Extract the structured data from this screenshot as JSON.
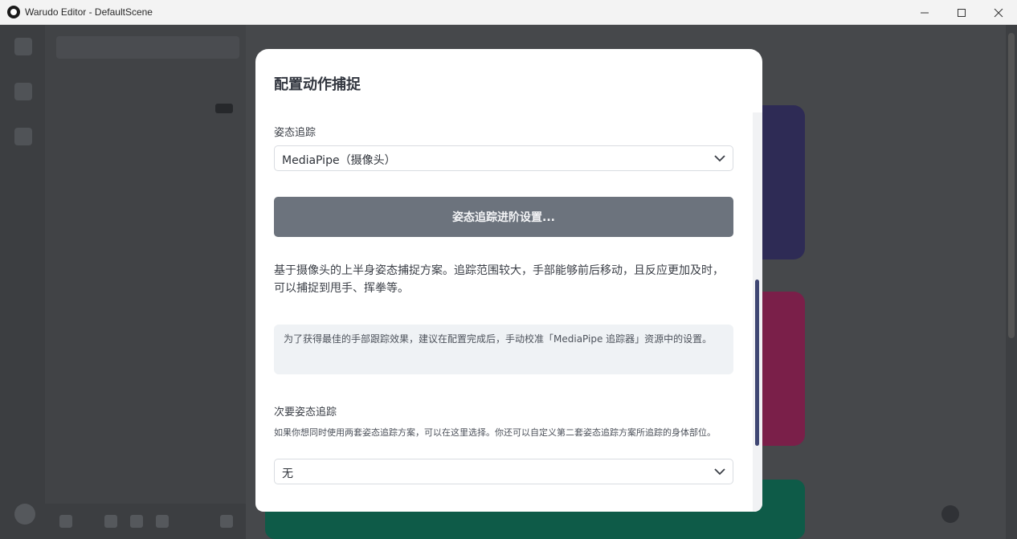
{
  "window": {
    "title": "Warudo Editor - DefaultScene",
    "minimize_icon": "minimize-icon",
    "maximize_icon": "maximize-icon",
    "close_icon": "close-icon"
  },
  "modal": {
    "title": "配置动作捕捉",
    "pose_tracking": {
      "label": "姿态追踪",
      "selected": "MediaPipe（摄像头）"
    },
    "advanced_button": "姿态追踪进阶设置...",
    "description": "基于摄像头的上半身姿态捕捉方案。追踪范围较大，手部能够前后移动，且反应更加及时，可以捕捉到甩手、挥拳等。",
    "note": "为了获得最佳的手部跟踪效果，建议在配置完成后，手动校准「MediaPipe 追踪器」资源中的设置。",
    "secondary_tracking": {
      "label": "次要姿态追踪",
      "help": "如果你想同时使用两套姿态追踪方案，可以在这里选择。你还可以自定义第二套姿态追踪方案所追踪的身体部位。",
      "selected": "无"
    }
  },
  "colors": {
    "accent_button": "#6c737d",
    "scrollbar_thumb": "#3f4773",
    "note_background": "#eff2f5"
  }
}
